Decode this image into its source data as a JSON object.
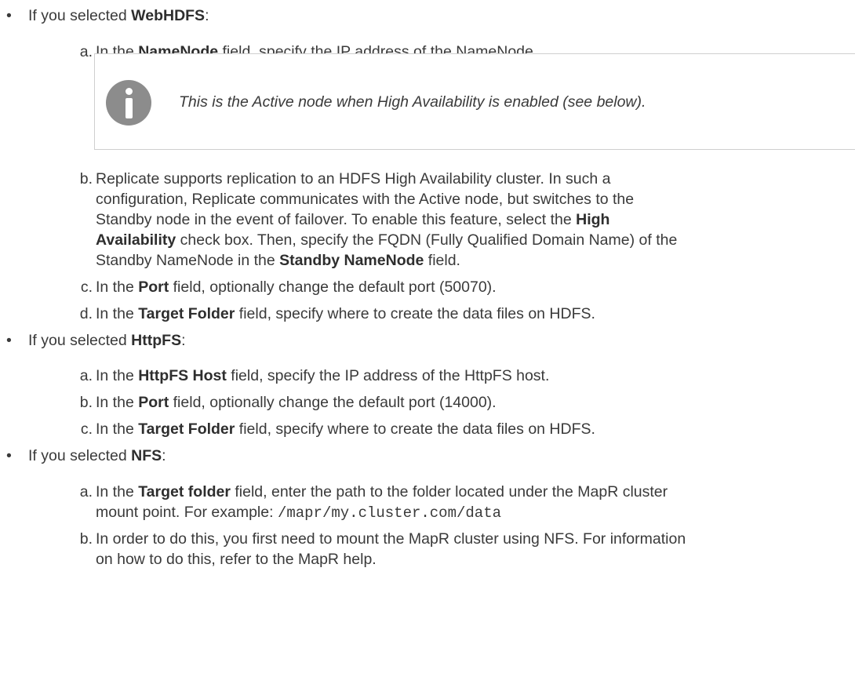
{
  "colors": {
    "text": "#3a3a3a",
    "note_border": "#cfcfcf",
    "info_icon": "#8c8c8c"
  },
  "webhdfs": {
    "intro": "If you selected ",
    "name": "WebHDFS",
    "steps": {
      "a": {
        "label": "a.",
        "pre": "In the ",
        "bold": "NameNode",
        "post": " field, specify the IP address of the NameNode."
      },
      "note": {
        "icon": "info-icon",
        "text": "This is the Active node when High Availability is enabled (see below)."
      },
      "b": {
        "label": "b.",
        "line1": "Replicate supports replication to an HDFS High Availability cluster. In such a",
        "line2": "configuration, Replicate communicates with the Active node, but switches to the",
        "line3_pre": "Standby node in the event of failover. To enable this feature, select the ",
        "line3_bold": "High",
        "line4_bold": "Availability",
        "line4_post": " check box. Then, specify the FQDN (Fully Qualified Domain Name) of the",
        "line5_pre": "Standby NameNode in the ",
        "line5_bold": "Standby NameNode",
        "line5_post": " field."
      },
      "c": {
        "label": "c.",
        "pre": "In the ",
        "bold": "Port",
        "post": " field, optionally change the default port (50070)."
      },
      "d": {
        "label": "d.",
        "pre": "In the ",
        "bold": "Target Folder",
        "post": " field, specify where to create the data files on HDFS."
      }
    }
  },
  "httpfs": {
    "intro": "If you selected ",
    "name": "HttpFS",
    "steps": {
      "a": {
        "label": "a.",
        "pre": "In the ",
        "bold": "HttpFS Host",
        "post": " field, specify the IP address of the HttpFS host."
      },
      "b": {
        "label": "b.",
        "pre": "In the ",
        "bold": "Port",
        "post": " field, optionally change the default port (14000)."
      },
      "c": {
        "label": "c.",
        "pre": "In the ",
        "bold": "Target Folder",
        "post": " field, specify where to create the data files on HDFS."
      }
    }
  },
  "nfs": {
    "intro": "If you selected ",
    "name": "NFS",
    "steps": {
      "a": {
        "label": "a.",
        "pre": "In the ",
        "bold": "Target folder",
        "post": " field, enter the path to the folder located under the MapR cluster",
        "line2_pre": "mount point. For example: ",
        "code": "/mapr/my.cluster.com/data"
      },
      "b": {
        "label": "b.",
        "line1": "In order to do this, you first need to mount the MapR cluster using NFS. For information",
        "line2": "on how to do this, refer to the MapR help."
      }
    }
  }
}
